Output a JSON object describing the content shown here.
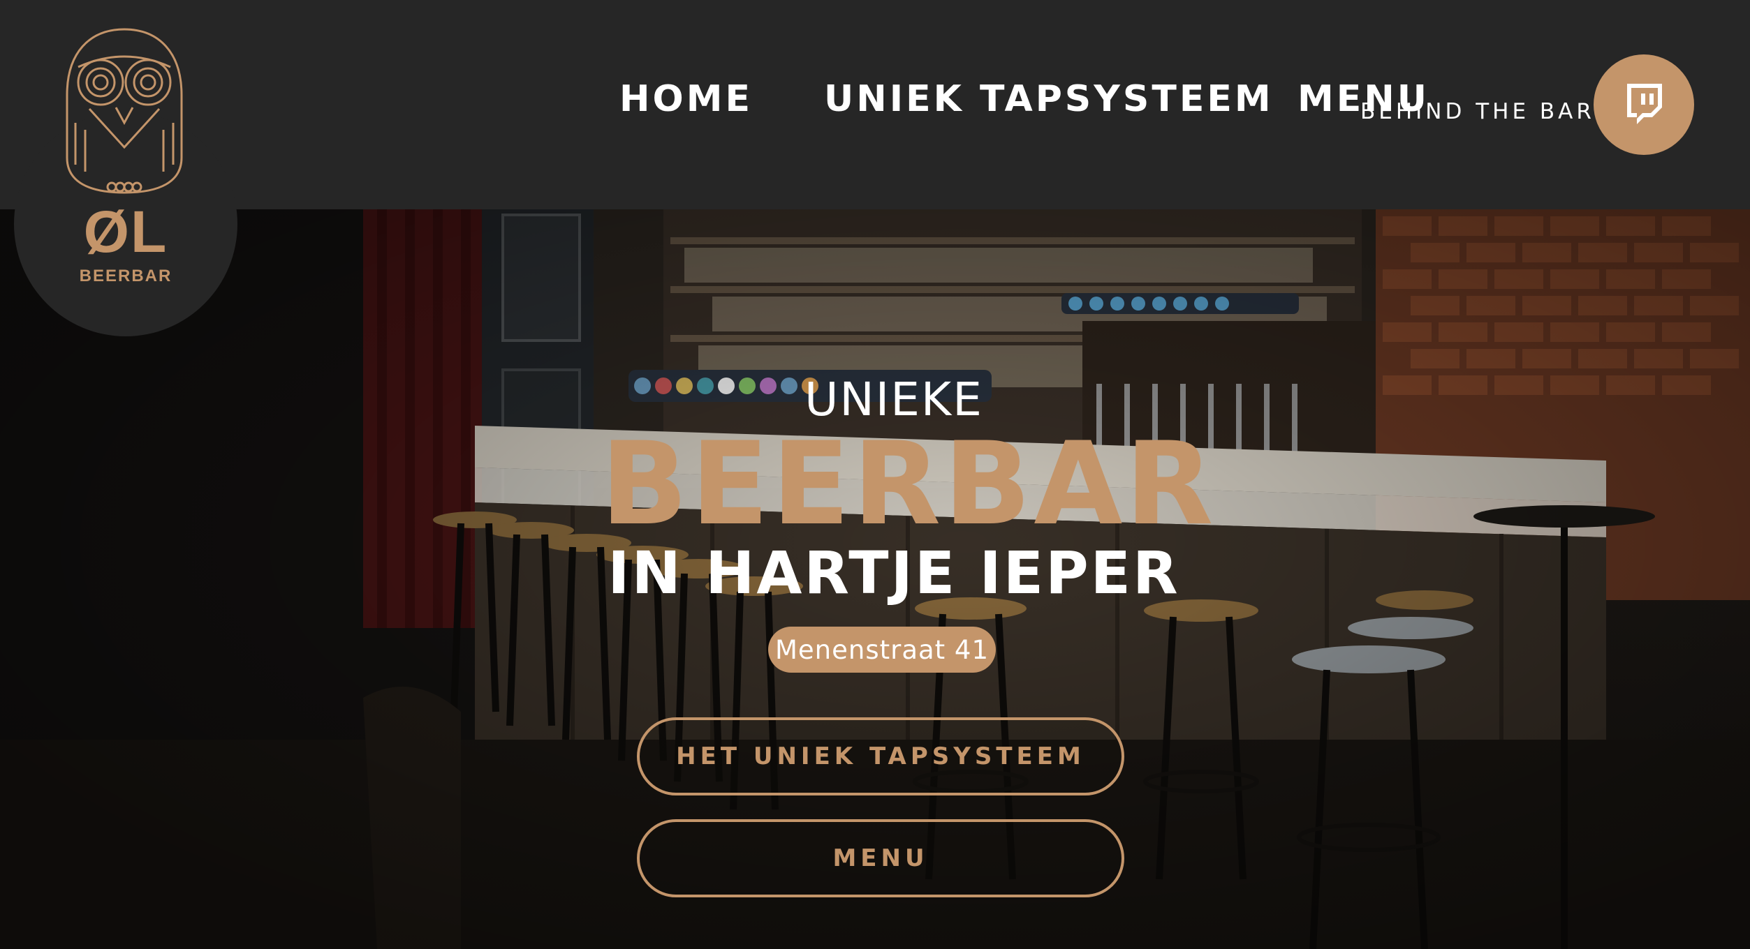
{
  "brand": {
    "logo_text": "ØL",
    "logo_subtext": "BEERBAR",
    "accent_color": "#c4956a",
    "header_bg": "#262626"
  },
  "nav": {
    "items": [
      {
        "label": "HOME"
      },
      {
        "label": "UNIEK TAPSYSTEEM"
      },
      {
        "label": "MENU"
      }
    ],
    "behind_the_bar": "BEHIND THE BAR",
    "social_icon": "twitch-icon"
  },
  "hero": {
    "kicker": "UNIEKE",
    "headline": "BEERBAR",
    "subhead": "IN HARTJE IEPER",
    "address": "Menenstraat 41",
    "buttons": [
      {
        "label": "HET UNIEK TAPSYSTEEM"
      },
      {
        "label": "MENU"
      }
    ]
  }
}
